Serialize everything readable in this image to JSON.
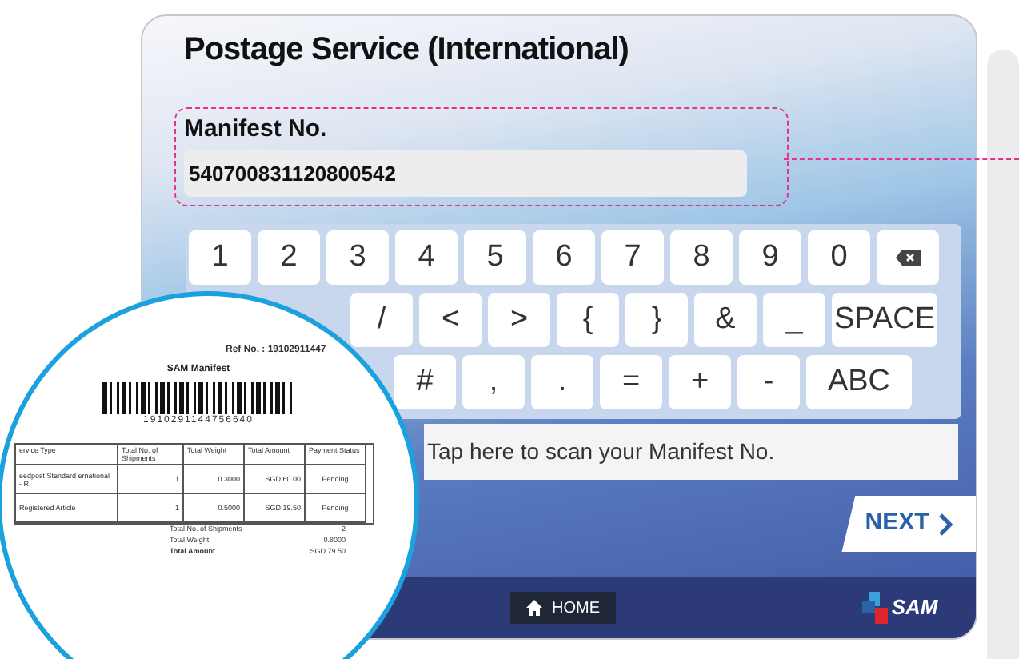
{
  "screen": {
    "title": "Postage Service (International)",
    "manifest_field": {
      "label": "Manifest No.",
      "value": "540700831120800542",
      "highlighted": true
    },
    "keyboard": {
      "number_row": [
        {
          "kind": "char",
          "label": "1"
        },
        {
          "kind": "char",
          "label": "2"
        },
        {
          "kind": "char",
          "label": "3"
        },
        {
          "kind": "char",
          "label": "4"
        },
        {
          "kind": "char",
          "label": "5"
        },
        {
          "kind": "char",
          "label": "6"
        },
        {
          "kind": "char",
          "label": "7"
        },
        {
          "kind": "char",
          "label": "8"
        },
        {
          "kind": "char",
          "label": "9"
        },
        {
          "kind": "char",
          "label": "0"
        },
        {
          "kind": "backspace"
        }
      ],
      "symbol_row": [
        {
          "kind": "char",
          "label": "/"
        },
        {
          "kind": "char",
          "label": "<"
        },
        {
          "kind": "char",
          "label": ">"
        },
        {
          "kind": "char",
          "label": "{"
        },
        {
          "kind": "char",
          "label": "}"
        },
        {
          "kind": "char",
          "label": "&"
        },
        {
          "kind": "char",
          "label": "_"
        },
        {
          "kind": "wide",
          "label": "SPACE"
        }
      ],
      "mode_row": [
        {
          "kind": "char",
          "label": "#"
        },
        {
          "kind": "char",
          "label": ","
        },
        {
          "kind": "char",
          "label": "."
        },
        {
          "kind": "char",
          "label": "="
        },
        {
          "kind": "char",
          "label": "+"
        },
        {
          "kind": "char",
          "label": "-"
        },
        {
          "kind": "wide",
          "label": "ABC"
        }
      ]
    },
    "scan_prompt": "Tap here to scan your Manifest No.",
    "next_button": "NEXT",
    "home_button": "HOME",
    "logo": "SAM"
  },
  "receipt": {
    "ref": "Ref No. : 19102911447",
    "title": "SAM Manifest",
    "barcode_number": "1910291144756640",
    "columns": [
      "ervice Type",
      "Total No. of Shipments",
      "Total Weight",
      "Total Amount",
      "Payment Status"
    ],
    "rows": [
      [
        "eedpost Standard ernational - R",
        "1",
        "0.3000",
        "SGD 60.00",
        "Pending"
      ],
      [
        "Registered Article",
        "1",
        "0.5000",
        "SGD 19.50",
        "Pending"
      ]
    ],
    "totals": [
      {
        "label": "Total No. of Shipments",
        "value": "2"
      },
      {
        "label": "Total Weight",
        "value": "0.8000"
      },
      {
        "label": "Total Amount",
        "value": "SGD 79.50"
      }
    ]
  }
}
